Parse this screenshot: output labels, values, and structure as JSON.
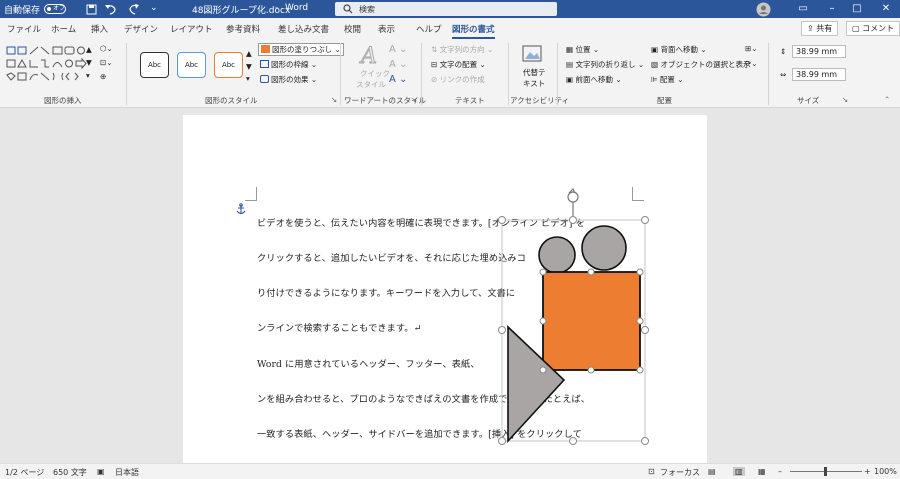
{
  "titlebar": {
    "autosave_label": "自動保存",
    "autosave_state": "オフ",
    "filename": "48図形グループ化.docx",
    "separator": "-",
    "app": "Word",
    "search_placeholder": "検索",
    "restore_icon": "□"
  },
  "tabs": [
    "ファイル",
    "ホーム",
    "挿入",
    "デザイン",
    "レイアウト",
    "参考資料",
    "差し込み文書",
    "校閲",
    "表示",
    "ヘルプ",
    "図形の書式"
  ],
  "share_label": "共有",
  "comment_label": "コメント",
  "ribbon": {
    "groups": {
      "insert_shapes": "図形の挿入",
      "shape_styles": "図形のスタイル",
      "wordart": "ワードアートのスタイル",
      "text": "テキスト",
      "accessibility": "アクセシビリティ",
      "arrange": "配置",
      "size": "サイズ"
    },
    "style_sample": "Abc",
    "fill": "図形の塗りつぶし",
    "outline": "図形の枠線",
    "effects": "図形の効果",
    "quick_style_1": "クイック",
    "quick_style_2": "スタイル",
    "text_direction": "文字列の方向",
    "text_align": "文字の配置",
    "create_link": "リンクの作成",
    "alt_text_1": "代替テ",
    "alt_text_2": "キスト",
    "position": "位置",
    "wrap_text": "文字列の折り返し",
    "bring_forward": "前面へ移動",
    "send_backward": "背面へ移動",
    "selection_pane": "オブジェクトの選択と表示",
    "align": "配置",
    "height": "38.99 mm",
    "width": "38.99 mm"
  },
  "document": {
    "lines": [
      "ビデオを使うと、伝えたい内容を明確に表現できます。[オンライン ビデオ] を",
      "クリックすると、追加したいビデオを、それに応じた埋め込みコ",
      "り付けできるようになります。キーワードを入力して、文書に",
      "ンラインで検索することもできます。↵",
      "Word に用意されているヘッダー、フッター、表紙、",
      "ンを組み合わせると、プロのようなできばえの文書を作成できます。たとえば、",
      "一致する表紙、ヘッダー、サイドバーを追加できます。[挿入] をクリックして"
    ]
  },
  "status": {
    "page": "1/2 ページ",
    "words": "650 文字",
    "language": "日本語",
    "focus": "フォーカス",
    "zoom": "100%"
  },
  "colors": {
    "brand": "#2b579a",
    "orange_shape": "#ed7d31",
    "gray_shape": "#a9a5a5"
  }
}
